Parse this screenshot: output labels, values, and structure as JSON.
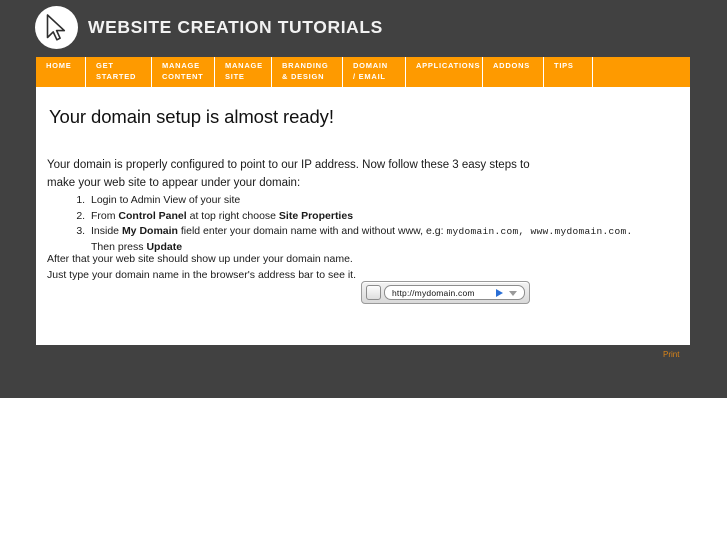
{
  "header": {
    "brand_title": "WEBSITE CREATION TUTORIALS",
    "logo_icon": "cursor-arrow-icon",
    "background_color": "#414141"
  },
  "nav": {
    "accent_color": "#fe9a00",
    "items": [
      {
        "label": "HOME",
        "width_class": "w-home"
      },
      {
        "label": "GET\nSTARTED",
        "width_class": "w-get"
      },
      {
        "label": "MANAGE\nCONTENT",
        "width_class": "w-content"
      },
      {
        "label": "MANAGE\nSITE",
        "width_class": "w-msite"
      },
      {
        "label": "BRANDING\n& DESIGN",
        "width_class": "w-brand"
      },
      {
        "label": "DOMAIN\n/ EMAIL",
        "width_class": "w-domain"
      },
      {
        "label": "APPLICATIONS",
        "width_class": "w-apps"
      },
      {
        "label": "ADDONS",
        "width_class": "w-addons"
      },
      {
        "label": "TIPS",
        "width_class": "w-tips"
      }
    ]
  },
  "main": {
    "title": "Your domain setup is almost ready!",
    "intro": "Your domain is properly configured to point to our IP address. Now follow these 3 easy steps to make your web site to appear under your domain:",
    "steps": [
      {
        "parts": [
          {
            "text": "Login to Admin View of your site",
            "style": "normal"
          }
        ]
      },
      {
        "parts": [
          {
            "text": "From ",
            "style": "normal"
          },
          {
            "text": "Control Panel",
            "style": "bold"
          },
          {
            "text": " at top right choose ",
            "style": "normal"
          },
          {
            "text": "Site Properties",
            "style": "bold"
          }
        ]
      },
      {
        "parts": [
          {
            "text": "Inside ",
            "style": "normal"
          },
          {
            "text": "My Domain",
            "style": "bold"
          },
          {
            "text": " field enter your domain name with and without www, e.g: ",
            "style": "normal"
          },
          {
            "text": "mydomain.com, www.mydomain.com.",
            "style": "mono"
          },
          {
            "text": " Then press ",
            "style": "normal"
          },
          {
            "text": "Update",
            "style": "bold"
          }
        ]
      }
    ],
    "outro": "After that your web site should show up under your domain name. Just type your domain name in the browser's address bar to see it."
  },
  "address_bar": {
    "url": "http://mydomain.com",
    "go_icon": "play-triangle-icon",
    "dropdown_icon": "chevron-down-icon",
    "favicon_icon": "blank-page-icon",
    "go_color": "#2a6fd6"
  },
  "footer": {
    "print_label": "Print",
    "print_color": "#d98418"
  }
}
